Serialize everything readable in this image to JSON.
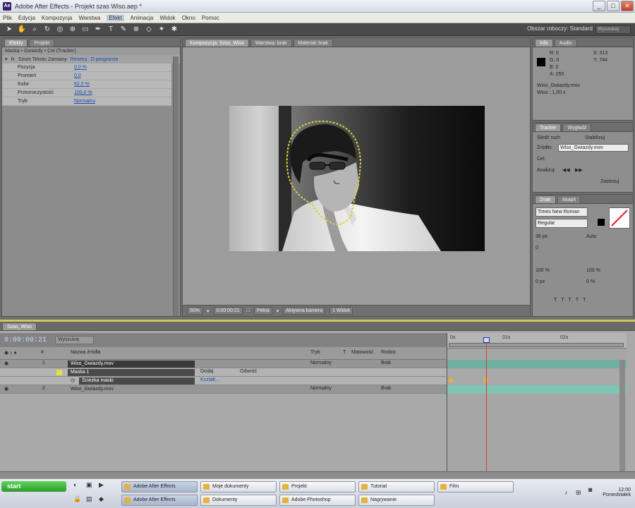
{
  "window": {
    "title": "Adobe After Effects - Projekt szas Wiso.aep *",
    "buttons": [
      "_",
      "□",
      "✕"
    ]
  },
  "menu": [
    "Plik",
    "Edycja",
    "Kompozycja",
    "Warstwa",
    "Efekt",
    "Animacja",
    "Widok",
    "Okno",
    "Pomoc"
  ],
  "toolbar": {
    "workspace_label": "Obszar roboczy: Standard",
    "search_placeholder": "Wyszukaj"
  },
  "effects_panel": {
    "tabs": [
      "Efekty",
      "Projekt"
    ],
    "path": "Maska • Gwiazdy • Cel (Tracker)",
    "effect_name": "Szum Tekstu Zamiany",
    "header_link1": "Resetuj",
    "header_link2": "O programie",
    "rows": [
      {
        "label": "Pozycja",
        "value": "0,0 %"
      },
      {
        "label": "Promień",
        "value": "0,0"
      },
      {
        "label": "Kolor",
        "value": "62,0 %"
      },
      {
        "label": "Przezroczystość",
        "value": "100,0 %"
      },
      {
        "label": "Tryb",
        "value": "Normalny"
      }
    ]
  },
  "comp_panel": {
    "tabs": [
      "Kompozycja: Szas_Wiso",
      "Warstwa: brak",
      "Materiał: brak"
    ],
    "footer": [
      "50%",
      "▾",
      "0:00:00:21",
      "□",
      "Pełna",
      "▾",
      "Aktywna kamera",
      "1 Widok"
    ]
  },
  "info_panel": {
    "tabs": [
      "Info",
      "Audio"
    ],
    "r": "R: 0",
    "g": "G: 0",
    "b": "B: 0",
    "a": "A: 255",
    "x": "X: 313",
    "y": "Y: 744",
    "clip1": "Wiso_Gwiazdy.mov",
    "clip2": "Wiso : 1,00 s"
  },
  "tracker_panel": {
    "tabs": [
      "Tracker",
      "Wygładź"
    ],
    "source_label": "Źródło:",
    "source_value": "Wiso_Gwiazdy.mov",
    "motion_label": "Śledź ruch",
    "stabilize_label": "Stabilizuj",
    "target_label": "Cel:",
    "analyze_label": "Analizuj:",
    "apply_label": "Zastosuj"
  },
  "char_panel": {
    "tabs": [
      "Znak",
      "Akapit"
    ],
    "font": "Times New Roman",
    "style": "Regular",
    "size": "36 px",
    "leading": "Auto",
    "tracking": "0",
    "scale_v": "100 %",
    "scale_h": "100 %",
    "baseline": "0 px",
    "tsume": "0 %"
  },
  "timeline": {
    "tab": "Szas_Wiso",
    "timecode": "0:00:00:21",
    "search": "Wyszukaj",
    "columns": [
      "#",
      "Nazwa źródła",
      "Tryb",
      "T",
      "Matowość",
      "Rodzic"
    ],
    "layers": [
      {
        "num": "1",
        "name": "Wiso_Gwiazdy.mov",
        "mode": "Normalny",
        "parent": "Brak"
      },
      {
        "num": "",
        "name": "Maska 1",
        "mode": "Dodaj",
        "parent": "Odwróć"
      },
      {
        "num": "",
        "name": "Ścieżka maski",
        "mode": "Kształt...",
        "parent": ""
      },
      {
        "num": "2",
        "name": "Wiso_Gwiazdy.mov",
        "mode": "Normalny",
        "parent": "Brak"
      }
    ],
    "ruler": [
      "0s",
      "01s",
      "02s"
    ]
  },
  "taskbar": {
    "start_label": "start",
    "tasks_row1": [
      "Adobe After Effects",
      "Moje dokumenty",
      "Projekt",
      "Tutorial",
      "Film"
    ],
    "tasks_row2": [
      "Adobe After Effects",
      "Dokumenty",
      "Adobe Photoshop",
      "Nagrywanie"
    ],
    "clock_time": "12:00",
    "clock_day": "Poniedziałek"
  }
}
